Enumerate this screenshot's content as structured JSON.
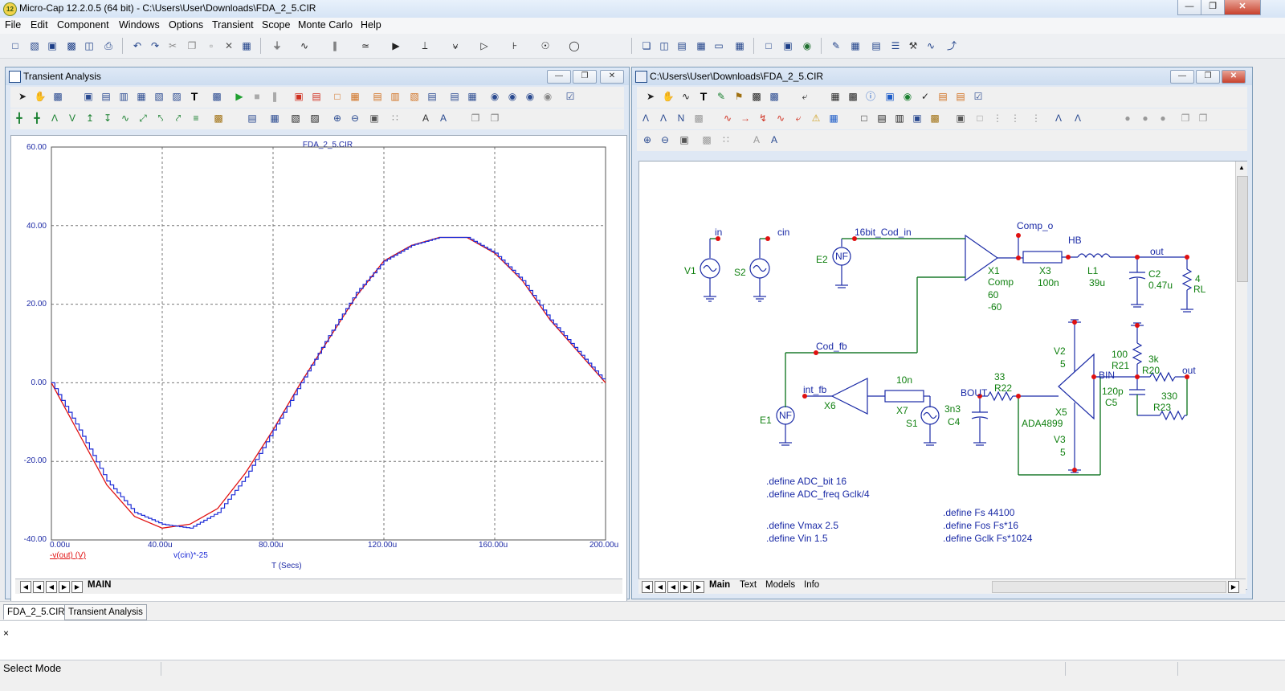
{
  "app": {
    "title": "Micro-Cap 12.2.0.5 (64 bit) - C:\\Users\\User\\Downloads\\FDA_2_5.CIR",
    "logo": "12"
  },
  "menu": [
    "File",
    "Edit",
    "Component",
    "Windows",
    "Options",
    "Transient",
    "Scope",
    "Monte Carlo",
    "Help"
  ],
  "transient_window": {
    "title": "Transient Analysis",
    "plot_title": "FDA_2_5.CIR",
    "y_ticks": [
      "60.00",
      "40.00",
      "20.00",
      "0.00",
      "-20.00",
      "-40.00"
    ],
    "x_ticks": [
      "0.00u",
      "40.00u",
      "80.00u",
      "120.00u",
      "160.00u",
      "200.00u"
    ],
    "trace1_label": "-v(out) (V)",
    "trace2_label": "v(cin)*-25",
    "x_axis_label": "T (Secs)",
    "tab_label": "MAIN",
    "colors": {
      "trace1": "#e01010",
      "trace2": "#1b2ad6",
      "axis_text": "#1d2aa6"
    }
  },
  "chart_data": {
    "type": "line",
    "title": "FDA_2_5.CIR",
    "xlabel": "T (Secs)",
    "xlim": [
      0,
      200
    ],
    "ylim": [
      -40,
      60
    ],
    "grid": true,
    "series": [
      {
        "name": "-v(out) (V)",
        "x": [
          0,
          10,
          20,
          30,
          40,
          50,
          60,
          70,
          80,
          90,
          100,
          110,
          120,
          130,
          140,
          150,
          160,
          170,
          180,
          190,
          200
        ],
        "values": [
          0,
          -13,
          -26,
          -34,
          -37,
          -36,
          -32,
          -23,
          -12,
          0,
          11,
          22,
          31,
          35,
          37,
          37,
          33,
          26,
          16,
          8,
          0
        ]
      },
      {
        "name": "v(cin)*-25",
        "x": [
          0,
          10,
          20,
          30,
          40,
          50,
          60,
          70,
          80,
          90,
          100,
          110,
          120,
          130,
          140,
          150,
          160,
          170,
          180,
          190,
          200
        ],
        "values": [
          0,
          -12,
          -25,
          -33,
          -36,
          -37,
          -33,
          -24,
          -12,
          0,
          12,
          23,
          31,
          35,
          37,
          37,
          33,
          26,
          16,
          8,
          0
        ]
      }
    ]
  },
  "schematic_window": {
    "title": "C:\\Users\\User\\Downloads\\FDA_2_5.CIR",
    "tabs": [
      "Main",
      "Text",
      "Models",
      "Info"
    ],
    "labels": {
      "in": "in",
      "cin": "cin",
      "v1": "V1",
      "s2": "S2",
      "e2": "E2",
      "nf": "NF",
      "net16": "16bit_Cod_in",
      "x1": "X1",
      "comp": "Comp",
      "comp60": "60",
      "comp_60": "-60",
      "comp_o": "Comp_o",
      "hb": "HB",
      "x3": "X3",
      "x3v": "100n",
      "l1": "L1",
      "l1v": "39u",
      "out": "out",
      "c2": "C2",
      "c2v": "0.47u",
      "rl4": "4",
      "rl": "RL",
      "cod_fb": "Cod_fb",
      "int_fb": "int_fb",
      "x6": "X6",
      "e1": "E1",
      "t10n": "10n",
      "x7": "X7",
      "s1": "S1",
      "bout": "BOUT",
      "r22v": "33",
      "r22": "R22",
      "c4v": "3n3",
      "c4": "C4",
      "v2": "V2",
      "v2v": "5",
      "x5": "X5",
      "ada": "ADA4899",
      "v3": "V3",
      "v3v": "5",
      "r21v": "100",
      "r21": "R21",
      "r20v": "3k",
      "r20": "R20",
      "bin": "BIN",
      "c5v": "120p",
      "c5": "C5",
      "r23v": "330",
      "r23": "R23",
      "out2": "out"
    },
    "defines": [
      ".define ADC_bit 16",
      ".define ADC_freq Gclk/4",
      ".define Vmax 2.5",
      ".define Vin 1.5",
      ".define Fs 44100",
      ".define Fos Fs*16",
      ".define Gclk Fs*1024"
    ]
  },
  "doc_tabs": [
    "FDA_2_5.CIR",
    "Transient Analysis"
  ],
  "output_close": "×",
  "status": {
    "mode": "Select Mode"
  }
}
